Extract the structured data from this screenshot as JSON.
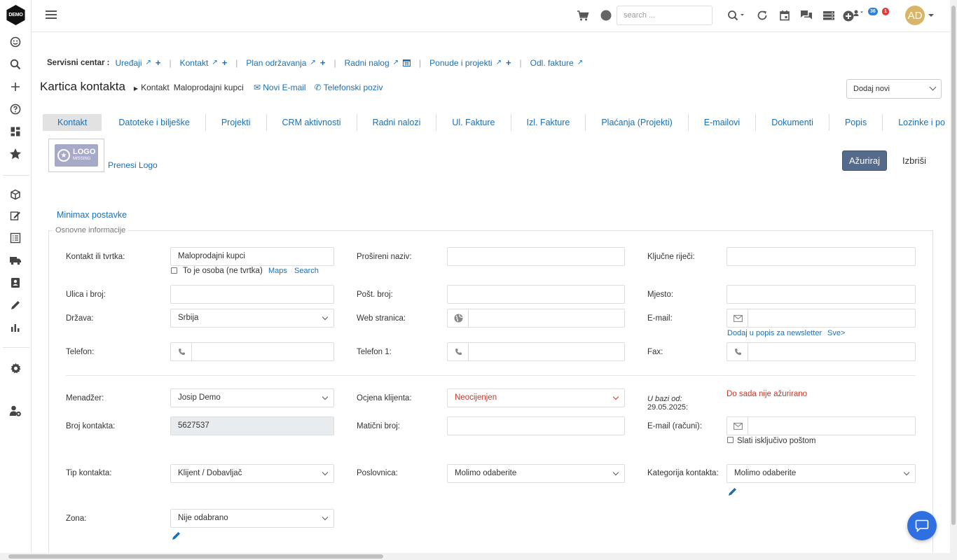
{
  "app": {
    "logo_text": "DEMO"
  },
  "topbar": {
    "search_placeholder": "search ...",
    "badge_blue": "36",
    "badge_red": "1",
    "avatar_initials": "AD"
  },
  "service_bar": {
    "label": "Servisni centar :",
    "items": [
      "Uređaji",
      "Kontakt",
      "Plan održavanja",
      "Radni nalog",
      "Ponude i projekti",
      "Odl. fakture"
    ]
  },
  "header": {
    "title": "Kartica kontakta",
    "crumb1": "Kontakt",
    "crumb2": "Maloprodajni kupci",
    "new_email": "Novi E-mail",
    "phone_call": "Telefonski poziv",
    "add_new": "Dodaj novi"
  },
  "tabs": [
    "Kontakt",
    "Datoteke i bilješke",
    "Projekti",
    "CRM aktivnosti",
    "Radni nalozi",
    "Ul. Fakture",
    "Izl. Fakture",
    "Plaćanja (Projekti)",
    "E-mailovi",
    "Dokumenti",
    "Popis",
    "Lozinke i po"
  ],
  "logo": {
    "big": "LOGO",
    "small": "MISSING",
    "upload": "Prenesi Logo"
  },
  "buttons": {
    "update": "Ažuriraj",
    "delete": "Izbriši"
  },
  "minimax": "Minimax postavke",
  "section_legend": "Osnovne informacije",
  "form": {
    "contact_label": "Kontakt ili tvrtka:",
    "contact_value": "Maloprodajni kupci",
    "is_person": "To je osoba (ne tvrtka)",
    "maps": "Maps",
    "search": "Search",
    "extended_label": "Prošireni naziv:",
    "keywords_label": "Ključne riječi:",
    "street_label": "Ulica i broj:",
    "postal_label": "Pošt. broj:",
    "city_label": "Mjesto:",
    "country_label": "Država:",
    "country_value": "Srbija",
    "web_label": "Web stranica:",
    "email_label": "E-mail:",
    "newsletter": "Dodaj u popis za newsletter",
    "all": "Sve>",
    "phone_label": "Telefon:",
    "phone1_label": "Telefon 1:",
    "fax_label": "Fax:",
    "manager_label": "Menadžer:",
    "manager_value": "Josip Demo",
    "rating_label": "Ocjena klijenta:",
    "rating_value": "Neocijenjen",
    "in_db_label": "U bazi od:",
    "in_db_date": "29.05.2025:",
    "not_updated": "Do sada nije ažurirano",
    "contact_no_label": "Broj kontakta:",
    "contact_no_value": "5627537",
    "reg_no_label": "Matični broj:",
    "email_invoice_label": "E-mail (računi):",
    "post_only": "Slati isključivo poštom",
    "type_label": "Tip kontakta:",
    "type_value": "Klijent / Dobavljač",
    "branch_label": "Poslovnica:",
    "branch_value": "Molimo odaberite",
    "category_label": "Kategorija kontakta:",
    "category_value": "Molimo odaberite",
    "zone_label": "Zona:",
    "zone_value": "Nije odabrano"
  },
  "colors": {
    "accent": "#1c6fb5",
    "update_btn": "#566a8c",
    "warning": "#c0392b",
    "chat": "#2f6fe0"
  }
}
